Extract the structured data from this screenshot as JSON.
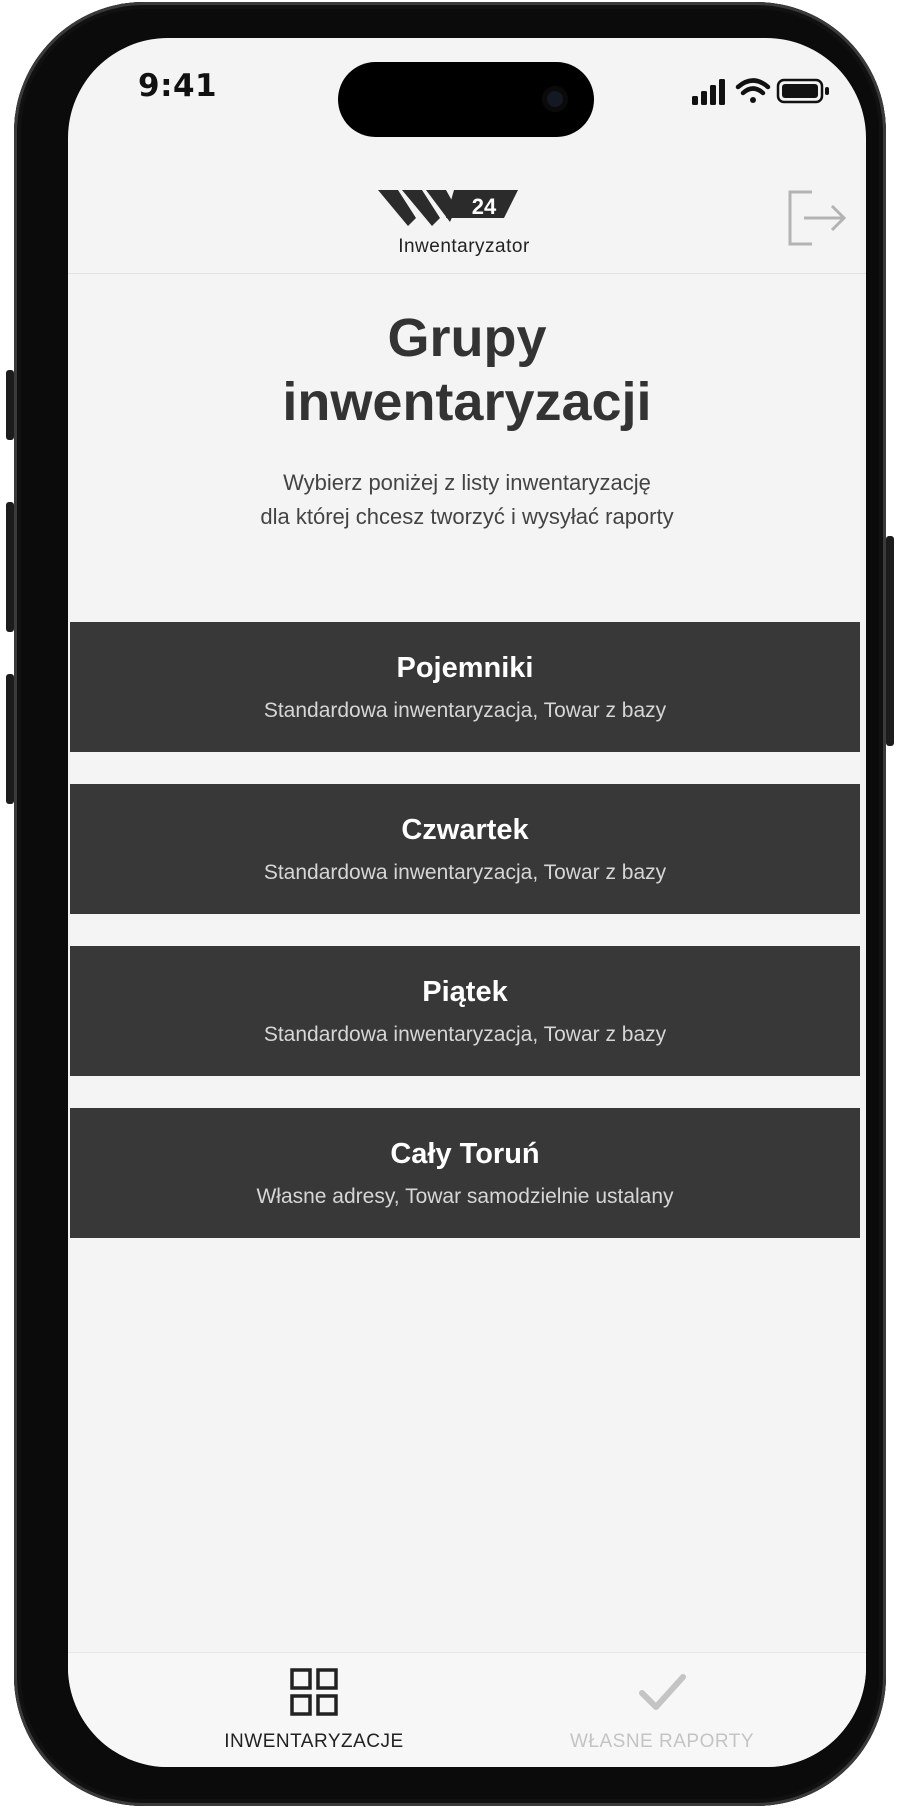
{
  "status_bar": {
    "time": "9:41"
  },
  "header": {
    "logo_number": "24",
    "logo_text": "Inwentaryzator"
  },
  "page": {
    "title_line1": "Grupy",
    "title_line2": "inwentaryzacji",
    "subtitle_line1": "Wybierz poniżej z listy inwentaryzację",
    "subtitle_line2": "dla której chcesz tworzyć i wysyłać raporty"
  },
  "groups": [
    {
      "name": "Pojemniki",
      "description": "Standardowa inwentaryzacja, Towar z bazy"
    },
    {
      "name": "Czwartek",
      "description": "Standardowa inwentaryzacja, Towar z bazy"
    },
    {
      "name": "Piątek",
      "description": "Standardowa inwentaryzacja, Towar z bazy"
    },
    {
      "name": "Cały Toruń",
      "description": "Własne adresy, Towar samodzielnie ustalany"
    }
  ],
  "tabs": [
    {
      "label": "INWENTARYZACJE",
      "icon": "grid-icon",
      "active": true
    },
    {
      "label": "WŁASNE RAPORTY",
      "icon": "checkmark-icon",
      "active": false
    }
  ],
  "colors": {
    "background": "#f4f4f4",
    "card": "#383838",
    "active_tab": "#222222",
    "inactive_tab": "#c4c4c4"
  }
}
